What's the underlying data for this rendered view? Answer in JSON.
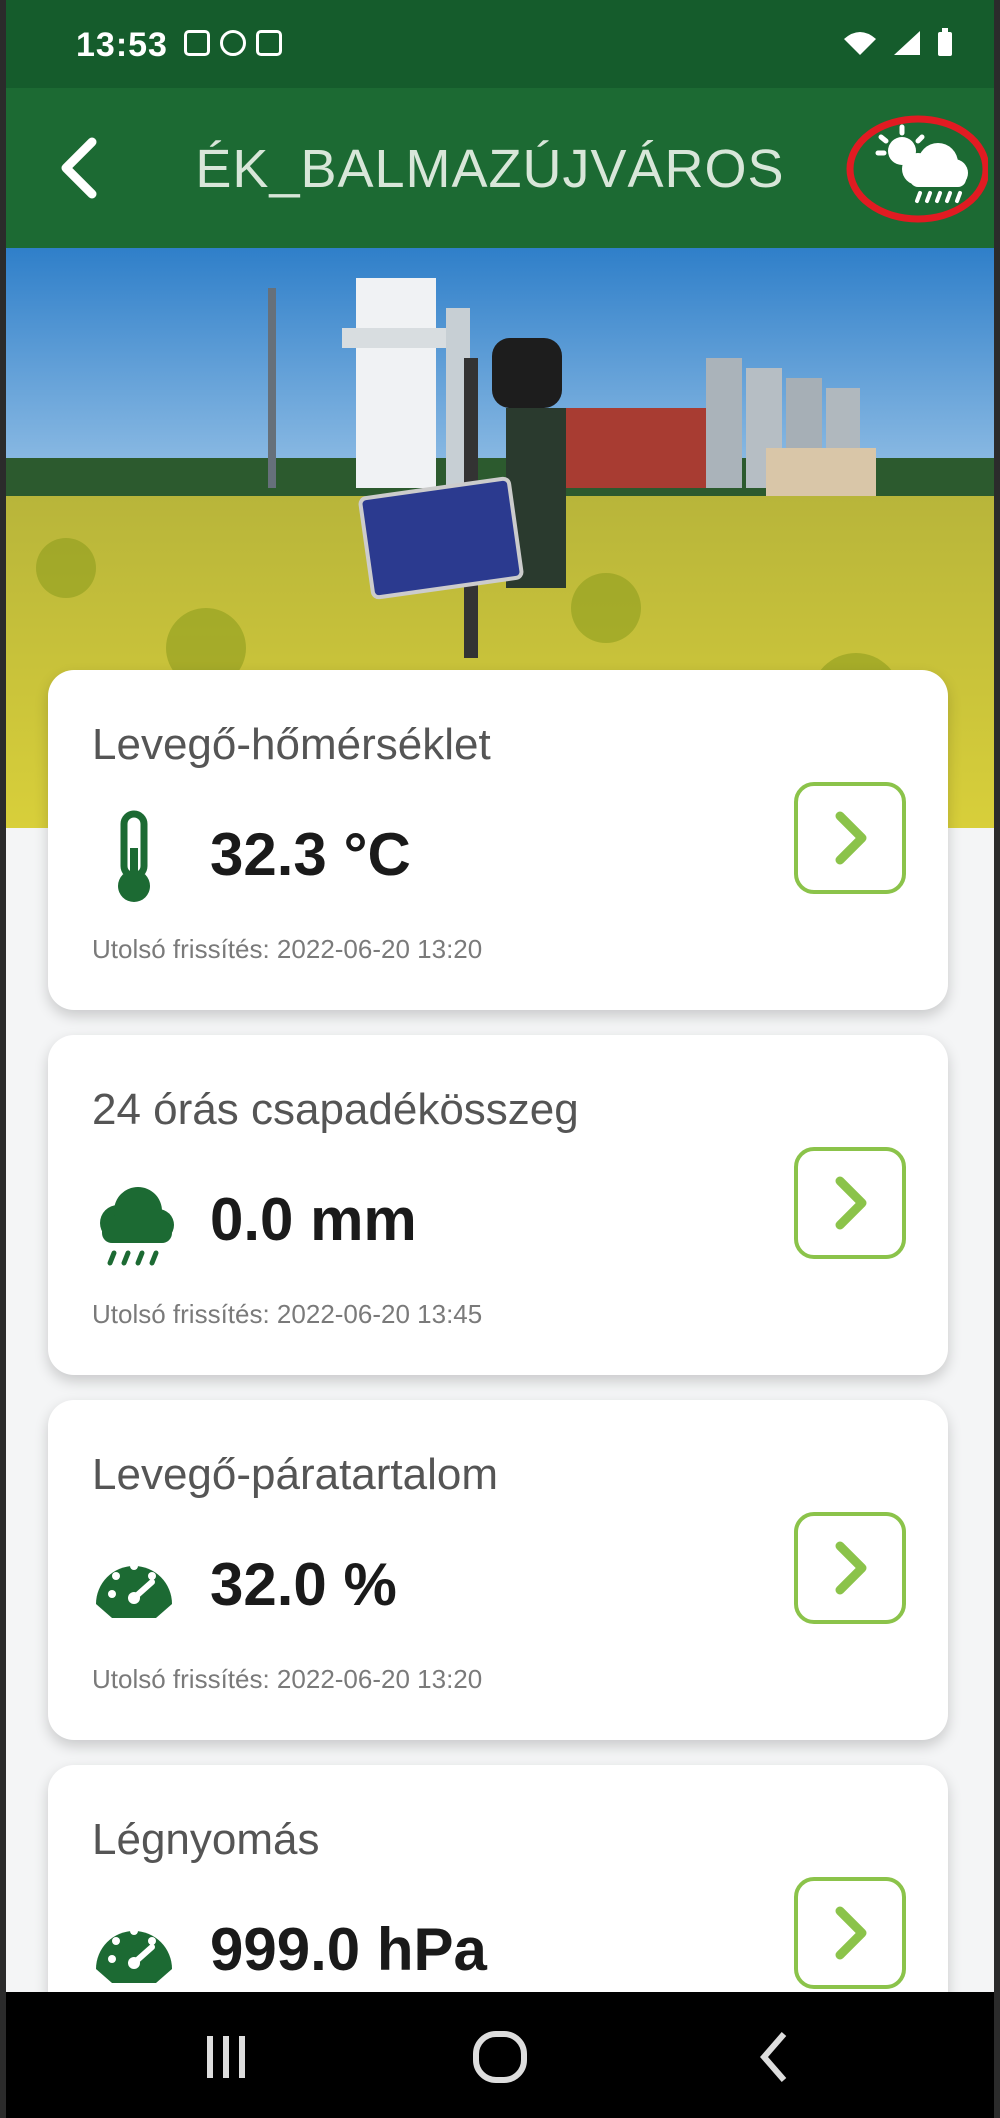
{
  "status_bar": {
    "time": "13:53"
  },
  "app_bar": {
    "title": "ÉK_BALMAZÚJVÁROS"
  },
  "colors": {
    "primary_dark": "#155c2c",
    "primary": "#1c6a33",
    "accent": "#8bc34a",
    "highlight": "#e11b22"
  },
  "cards": [
    {
      "label": "Levegő-hőmérséklet",
      "value": "32.3 °C",
      "updated": "Utolsó frissítés: 2022-06-20 13:20",
      "icon": "thermometer-icon"
    },
    {
      "label": "24 órás csapadékösszeg",
      "value": "0.0 mm",
      "updated": "Utolsó frissítés: 2022-06-20 13:45",
      "icon": "rain-cloud-icon"
    },
    {
      "label": "Levegő-páratartalom",
      "value": "32.0 %",
      "updated": "Utolsó frissítés: 2022-06-20 13:20",
      "icon": "gauge-icon"
    },
    {
      "label": "Légnyomás",
      "value": "999.0 hPa",
      "updated": "",
      "icon": "gauge-icon"
    }
  ]
}
